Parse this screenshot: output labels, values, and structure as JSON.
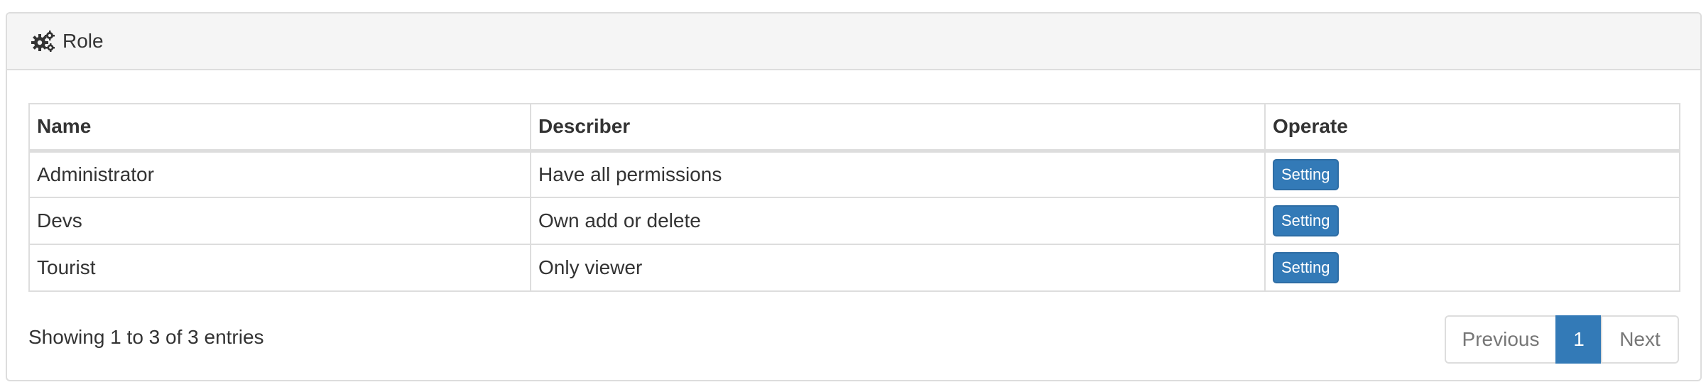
{
  "panel": {
    "icon": "gears-icon",
    "title": "Role"
  },
  "table": {
    "headers": [
      "Name",
      "Describer",
      "Operate"
    ],
    "rows": [
      {
        "name": "Administrator",
        "describer": "Have all permissions",
        "action": "Setting"
      },
      {
        "name": "Devs",
        "describer": "Own add or delete",
        "action": "Setting"
      },
      {
        "name": "Tourist",
        "describer": "Only viewer",
        "action": "Setting"
      }
    ]
  },
  "footer": {
    "info": "Showing 1 to 3 of 3 entries",
    "pagination": {
      "previous": "Previous",
      "current_page": "1",
      "next": "Next"
    }
  },
  "colors": {
    "primary": "#337ab7",
    "border": "#dddddd",
    "heading_bg": "#f5f5f5"
  }
}
